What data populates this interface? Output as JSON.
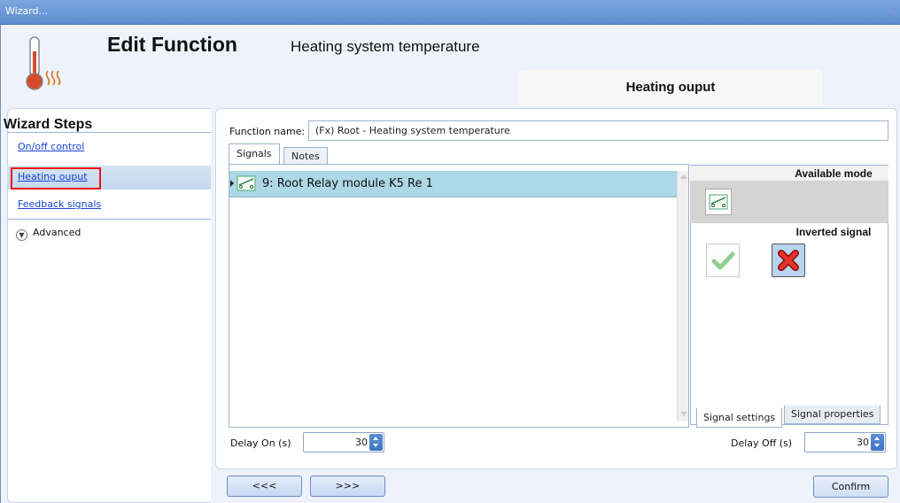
{
  "window": {
    "title": "Wizard...",
    "close_glyph": "✕"
  },
  "header": {
    "title": "Edit Function",
    "subtitle": "Heating system temperature",
    "step_tab": "Heating ouput",
    "icon": "thermometer-heat-icon"
  },
  "wizard": {
    "heading": "Wizard Steps",
    "steps": [
      {
        "label": "On/off control"
      },
      {
        "label": "Heating ouput",
        "active": true
      },
      {
        "label": "Feedback signals"
      }
    ],
    "advanced": "Advanced"
  },
  "function": {
    "name_label": "Function name:",
    "name_value": "(Fx) Root - Heating system temperature"
  },
  "tabs": {
    "signals": "Signals",
    "notes": "Notes"
  },
  "signals": [
    {
      "label": "9: Root Relay module K5 Re 1",
      "icon": "relay-icon"
    }
  ],
  "side_panel": {
    "available_mode": "Available mode",
    "inverted_signal": "Inverted signal",
    "tabs": {
      "settings": "Signal settings",
      "properties": "Signal properties"
    }
  },
  "delay": {
    "on_label": "Delay On (s)",
    "on_value": "30",
    "off_label": "Delay Off (s)",
    "off_value": "30"
  },
  "buttons": {
    "back": "<<<",
    "next": ">>>",
    "confirm": "Confirm"
  },
  "colors": {
    "title_bar": "#5b8bd0",
    "selection": "#add8e6",
    "highlight_border": "#e11111"
  }
}
